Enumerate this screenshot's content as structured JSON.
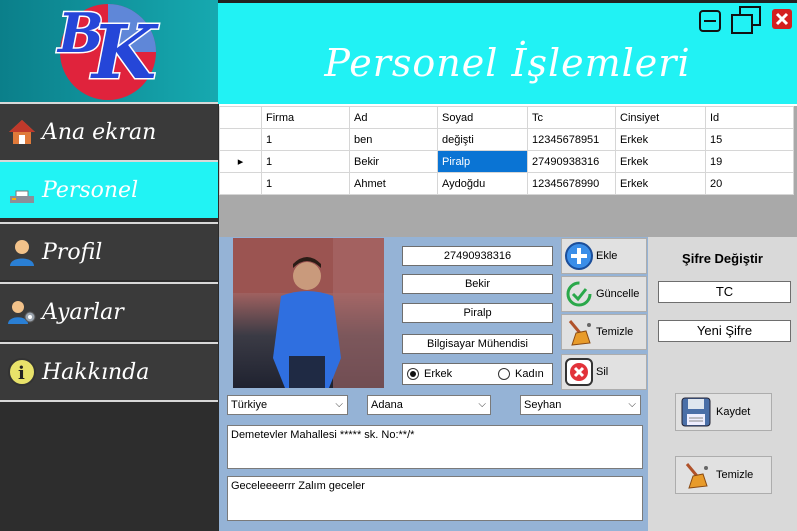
{
  "header": {
    "title": "Personel İşlemleri"
  },
  "sidebar": {
    "logo_text": "BK",
    "items": [
      {
        "label": "Ana ekran",
        "icon": "home-icon"
      },
      {
        "label": "Personel",
        "icon": "printer-icon"
      },
      {
        "label": "Profil",
        "icon": "user-icon"
      },
      {
        "label": "Ayarlar",
        "icon": "user-settings-icon"
      },
      {
        "label": "Hakkında",
        "icon": "info-icon"
      }
    ]
  },
  "grid": {
    "columns": [
      "Firma",
      "Ad",
      "Soyad",
      "Tc",
      "Cinsiyet",
      "Id"
    ],
    "rows": [
      [
        "1",
        "ben",
        "değişti",
        "12345678951",
        "Erkek",
        "15"
      ],
      [
        "1",
        "Bekir",
        "Piralp",
        "27490938316",
        "Erkek",
        "19"
      ],
      [
        "1",
        "Ahmet",
        "Aydoğdu",
        "12345678990",
        "Erkek",
        "20"
      ]
    ]
  },
  "form": {
    "tc": "27490938316",
    "ad": "Bekir",
    "soyad": "Piralp",
    "meslek": "Bilgisayar Mühendisi",
    "gender_male": "Erkek",
    "gender_female": "Kadın",
    "ulke": "Türkiye",
    "il": "Adana",
    "ilce": "Seyhan",
    "adres": "Demetevler Mahallesi ***** sk. No:**/*",
    "not": "Geceleeeerrr Zalım geceler"
  },
  "actions": {
    "ekle": "Ekle",
    "guncelle": "Güncelle",
    "temizle": "Temizle",
    "sil": "Sil"
  },
  "password": {
    "title": "Şifre Değiştir",
    "tc_value": "TC",
    "new_value": "Yeni Şifre",
    "kaydet": "Kaydet",
    "temizle": "Temizle"
  }
}
